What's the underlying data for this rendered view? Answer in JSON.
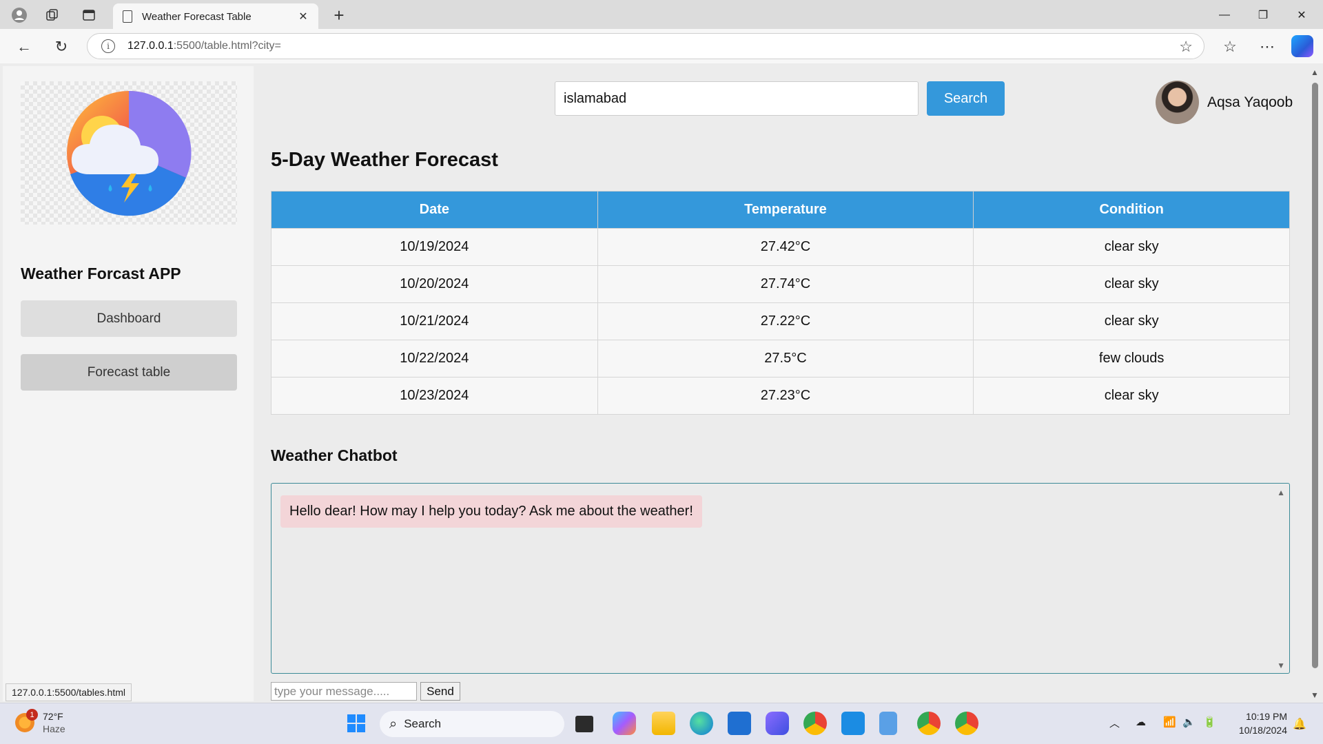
{
  "browser": {
    "tab_title": "Weather Forecast Table",
    "url_host": "127.0.0.1",
    "url_path": ":5500/table.html?city=",
    "status_url": "127.0.0.1:5500/tables.html"
  },
  "sidebar": {
    "app_title": "Weather Forcast APP",
    "nav": [
      {
        "label": "Dashboard"
      },
      {
        "label": "Forecast table"
      }
    ]
  },
  "header": {
    "search_value": "islamabad",
    "search_button": "Search",
    "user_name": "Aqsa Yaqoob"
  },
  "forecast": {
    "title": "5-Day Weather Forecast",
    "columns": [
      "Date",
      "Temperature",
      "Condition"
    ],
    "rows": [
      {
        "date": "10/19/2024",
        "temperature": "27.42°C",
        "condition": "clear sky"
      },
      {
        "date": "10/20/2024",
        "temperature": "27.74°C",
        "condition": "clear sky"
      },
      {
        "date": "10/21/2024",
        "temperature": "27.22°C",
        "condition": "clear sky"
      },
      {
        "date": "10/22/2024",
        "temperature": "27.5°C",
        "condition": "few clouds"
      },
      {
        "date": "10/23/2024",
        "temperature": "27.23°C",
        "condition": "clear sky"
      }
    ]
  },
  "chatbot": {
    "title": "Weather Chatbot",
    "messages": [
      "Hello dear! How may I help you today? Ask me about the weather!"
    ],
    "input_placeholder": "type your message.....",
    "send_label": "Send"
  },
  "taskbar": {
    "weather_temp": "72°F",
    "weather_cond": "Haze",
    "weather_badge": "1",
    "search_label": "Search",
    "time": "10:19 PM",
    "date": "10/18/2024"
  },
  "colors": {
    "accent": "#3498db",
    "chat_bubble": "#f3d5d8"
  }
}
